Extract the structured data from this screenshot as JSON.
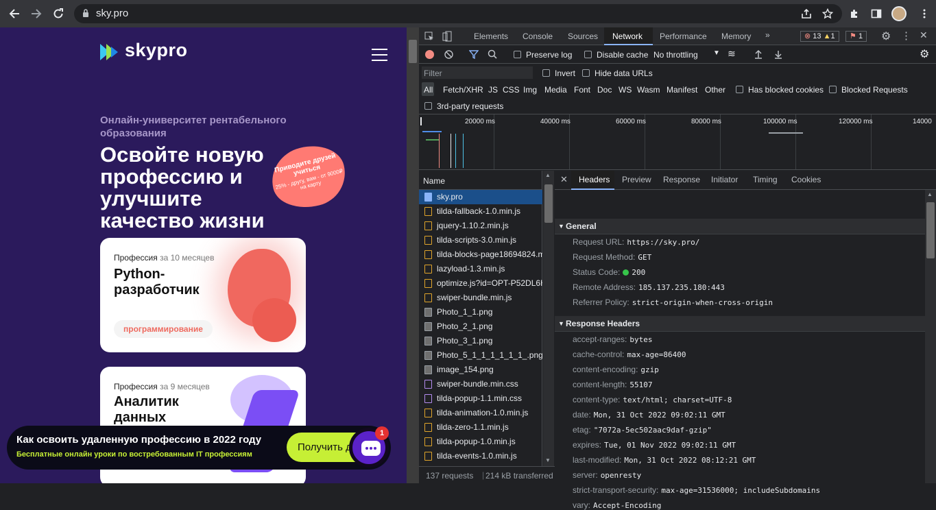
{
  "browser": {
    "url": "sky.pro",
    "back_icon": "arrow-left",
    "forward_icon": "arrow-right",
    "reload_icon": "reload",
    "share_icon": "share",
    "star_icon": "star",
    "extensions_icon": "puzzle",
    "sidepanel_icon": "panel",
    "menu_icon": "kebab"
  },
  "site": {
    "logo_text": "skypro",
    "eyebrow": "Онлайн-университет рентабельного образования",
    "hero": "Освойте новую профессию и улучшите качество жизни",
    "sticker": {
      "line1": "Приводите друзей учиться",
      "line2": "25% - другу, вам - от 9000₽ на карту"
    },
    "cards": [
      {
        "meta_prefix": "Профессия",
        "meta_duration": "за 10 месяцев",
        "title": "Python-разработчик",
        "tag": "программирование"
      },
      {
        "meta_prefix": "Профессия",
        "meta_duration": "за 9 месяцев",
        "title": "Аналитик данных"
      }
    ],
    "banner": {
      "title": "Как освоить удаленную профессию в 2022 году",
      "subtitle": "Бесплатные онлайн уроки по востребованным IT профессиям",
      "button": "Получить доступ"
    },
    "chat_badge": "1"
  },
  "devtools": {
    "tabs": [
      "Elements",
      "Console",
      "Sources",
      "Network",
      "Performance",
      "Memory"
    ],
    "active_tab": "Network",
    "more_tabs": "»",
    "errors": "13",
    "warnings": "1",
    "issues": "1",
    "toolbar": {
      "preserve_log": "Preserve log",
      "disable_cache": "Disable cache",
      "throttling": "No throttling"
    },
    "filter": {
      "placeholder": "Filter",
      "invert": "Invert",
      "hide_data_urls": "Hide data URLs"
    },
    "types": [
      "All",
      "Fetch/XHR",
      "JS",
      "CSS",
      "Img",
      "Media",
      "Font",
      "Doc",
      "WS",
      "Wasm",
      "Manifest",
      "Other"
    ],
    "has_blocked_cookies": "Has blocked cookies",
    "blocked_requests": "Blocked Requests",
    "third_party": "3rd-party requests",
    "timeline_labels": [
      "20000 ms",
      "40000 ms",
      "60000 ms",
      "80000 ms",
      "100000 ms",
      "120000 ms",
      "14000"
    ],
    "name_header": "Name",
    "requests": [
      {
        "name": "sky.pro",
        "type": "doc"
      },
      {
        "name": "tilda-fallback-1.0.min.js",
        "type": "js"
      },
      {
        "name": "jquery-1.10.2.min.js",
        "type": "js"
      },
      {
        "name": "tilda-scripts-3.0.min.js",
        "type": "js"
      },
      {
        "name": "tilda-blocks-page18694824.m",
        "type": "js"
      },
      {
        "name": "lazyload-1.3.min.js",
        "type": "js"
      },
      {
        "name": "optimize.js?id=OPT-P52DL6H",
        "type": "js"
      },
      {
        "name": "swiper-bundle.min.js",
        "type": "js"
      },
      {
        "name": "Photo_1_1.png",
        "type": "img"
      },
      {
        "name": "Photo_2_1.png",
        "type": "img"
      },
      {
        "name": "Photo_3_1.png",
        "type": "img"
      },
      {
        "name": "Photo_5_1_1_1_1_1_1_.png",
        "type": "img"
      },
      {
        "name": "image_154.png",
        "type": "img"
      },
      {
        "name": "swiper-bundle.min.css",
        "type": "css"
      },
      {
        "name": "tilda-popup-1.1.min.css",
        "type": "css"
      },
      {
        "name": "tilda-animation-1.0.min.js",
        "type": "js"
      },
      {
        "name": "tilda-zero-1.1.min.js",
        "type": "js"
      },
      {
        "name": "tilda-popup-1.0.min.js",
        "type": "js"
      },
      {
        "name": "tilda-events-1.0.min.js",
        "type": "js"
      }
    ],
    "status_requests": "137 requests",
    "status_transferred": "214 kB transferred",
    "detail_tabs": [
      "Headers",
      "Preview",
      "Response",
      "Initiator",
      "Timing",
      "Cookies"
    ],
    "active_detail_tab": "Headers",
    "general_title": "General",
    "general": [
      {
        "k": "Request URL:",
        "v": "https://sky.pro/"
      },
      {
        "k": "Request Method:",
        "v": "GET"
      },
      {
        "k": "Status Code:",
        "v": "200"
      },
      {
        "k": "Remote Address:",
        "v": "185.137.235.180:443"
      },
      {
        "k": "Referrer Policy:",
        "v": "strict-origin-when-cross-origin"
      }
    ],
    "response_title": "Response Headers",
    "response_headers": [
      {
        "k": "accept-ranges:",
        "v": "bytes"
      },
      {
        "k": "cache-control:",
        "v": "max-age=86400"
      },
      {
        "k": "content-encoding:",
        "v": "gzip"
      },
      {
        "k": "content-length:",
        "v": "55107"
      },
      {
        "k": "content-type:",
        "v": "text/html; charset=UTF-8"
      },
      {
        "k": "date:",
        "v": "Mon, 31 Oct 2022 09:02:11 GMT"
      },
      {
        "k": "etag:",
        "v": "\"7072a-5ec502aac9daf-gzip\""
      },
      {
        "k": "expires:",
        "v": "Tue, 01 Nov 2022 09:02:11 GMT"
      },
      {
        "k": "last-modified:",
        "v": "Mon, 31 Oct 2022 08:12:21 GMT"
      },
      {
        "k": "server:",
        "v": "openresty"
      },
      {
        "k": "strict-transport-security:",
        "v": "max-age=31536000; includeSubdomains"
      },
      {
        "k": "vary:",
        "v": "Accept-Encoding"
      }
    ]
  }
}
